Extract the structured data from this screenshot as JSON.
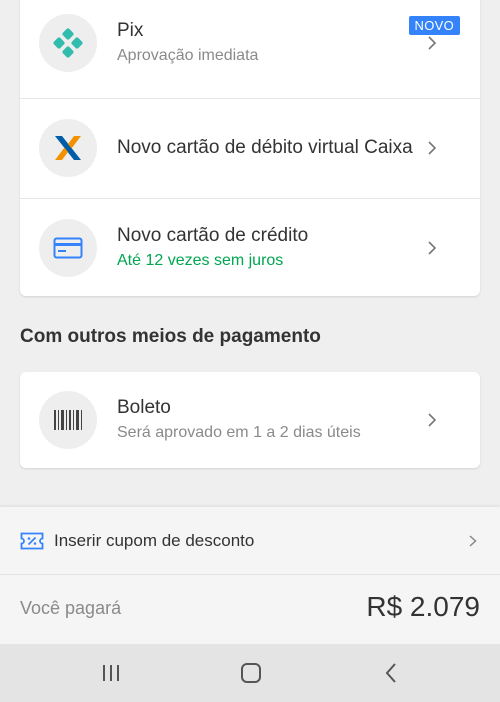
{
  "payment_methods": [
    {
      "title": "Pix",
      "subtitle": "Aprovação imediata",
      "badge": "NOVO",
      "icon": "pix-icon"
    },
    {
      "title": "Novo cartão de débito virtual Caixa",
      "subtitle": "",
      "icon": "caixa-logo-icon"
    },
    {
      "title": "Novo cartão de crédito",
      "subtitle": "Até 12 vezes sem juros",
      "icon": "credit-card-icon"
    }
  ],
  "other_section": {
    "title": "Com outros meios de pagamento",
    "items": [
      {
        "title": "Boleto",
        "subtitle": "Será aprovado em 1 a 2 dias úteis",
        "icon": "barcode-icon"
      }
    ]
  },
  "summary": {
    "coupon_label": "Inserir cupom de desconto",
    "total_label": "Você pagará",
    "total_value": "R$ 2.079"
  },
  "colors": {
    "accent_blue": "#3483fa",
    "green": "#00a650",
    "pix_teal": "#32bcad",
    "caixa_blue": "#005ca9",
    "caixa_orange": "#f39200"
  },
  "nav_icons": [
    "recents-icon",
    "home-icon",
    "back-icon"
  ]
}
